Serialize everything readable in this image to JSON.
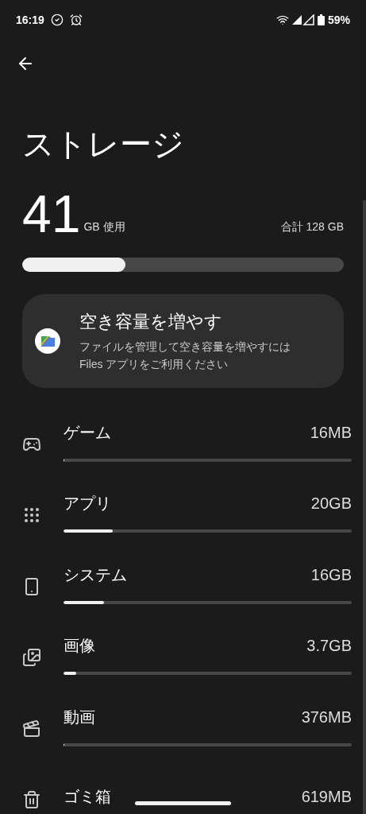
{
  "status_bar": {
    "time": "16:19",
    "battery": "59%"
  },
  "title": "ストレージ",
  "usage": {
    "used": "41",
    "unit": "GB 使用",
    "total": "合計 128 GB",
    "level": 0.32
  },
  "promo": {
    "title": "空き容量を増やす",
    "text": "ファイルを管理して空き容量を増やすには Files アプリをご利用ください"
  },
  "categories": [
    {
      "kind": "games",
      "label": "ゲーム",
      "size": "16MB",
      "level": 0.003
    },
    {
      "kind": "apps",
      "label": "アプリ",
      "size": "20GB",
      "level": 0.17
    },
    {
      "kind": "system",
      "label": "システム",
      "size": "16GB",
      "level": 0.14
    },
    {
      "kind": "images",
      "label": "画像",
      "size": "3.7GB",
      "level": 0.045
    },
    {
      "kind": "videos",
      "label": "動画",
      "size": "376MB",
      "level": 0.004
    },
    {
      "kind": "trash",
      "label": "ゴミ箱",
      "size": "619MB"
    }
  ]
}
